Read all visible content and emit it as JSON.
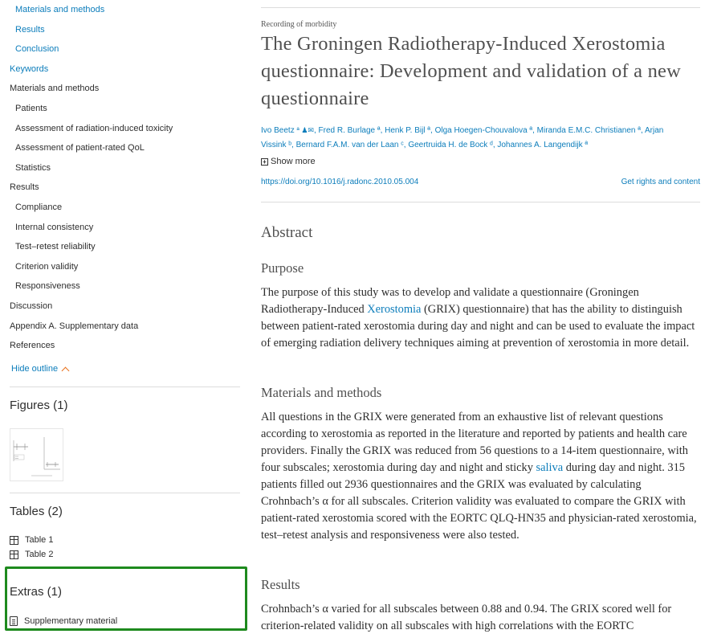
{
  "outline": {
    "items": [
      {
        "label": "Materials and methods",
        "level": 2,
        "link": true
      },
      {
        "label": "Results",
        "level": 2,
        "link": true
      },
      {
        "label": "Conclusion",
        "level": 2,
        "link": true
      },
      {
        "label": "Keywords",
        "level": 1,
        "link": true
      },
      {
        "label": "Materials and methods",
        "level": 1,
        "link": false
      },
      {
        "label": "Patients",
        "level": 2,
        "link": false
      },
      {
        "label": "Assessment of radiation-induced toxicity",
        "level": 2,
        "link": false
      },
      {
        "label": "Assessment of patient-rated QoL",
        "level": 2,
        "link": false
      },
      {
        "label": "Statistics",
        "level": 2,
        "link": false
      },
      {
        "label": "Results",
        "level": 1,
        "link": false
      },
      {
        "label": "Compliance",
        "level": 2,
        "link": false
      },
      {
        "label": "Internal consistency",
        "level": 2,
        "link": false
      },
      {
        "label": "Test–retest reliability",
        "level": 2,
        "link": false
      },
      {
        "label": "Criterion validity",
        "level": 2,
        "link": false
      },
      {
        "label": "Responsiveness",
        "level": 2,
        "link": false
      },
      {
        "label": "Discussion",
        "level": 1,
        "link": false
      },
      {
        "label": "Appendix A. Supplementary data",
        "level": 1,
        "link": false
      },
      {
        "label": "References",
        "level": 1,
        "link": false
      }
    ],
    "hide_label": "Hide outline"
  },
  "figures": {
    "title": "Figures (1)"
  },
  "tables": {
    "title": "Tables (2)",
    "items": [
      "Table 1",
      "Table 2"
    ]
  },
  "extras": {
    "title": "Extras (1)",
    "items": [
      "Supplementary material"
    ]
  },
  "article": {
    "subject": "Recording of morbidity",
    "title": "The Groningen Radiotherapy-Induced Xerostomia questionnaire: Development and validation of a new questionnaire",
    "authors_line1": "Ivo Beetz",
    "authors_line1_rest": ", Fred R. Burlage ª, Henk P. Bijl ª, Olga Hoegen-Chouvalova ª, Miranda E.M.C. Christianen ª, Arjan",
    "authors_line2": "Vissink ᵇ, Bernard F.A.M. van der Laan ᶜ, Geertruida H. de Bock ᵈ, Johannes A. Langendijk ª",
    "show_more": "Show more",
    "doi": "https://doi.org/10.1016/j.radonc.2010.05.004",
    "rights": "Get rights and content"
  },
  "abstract": {
    "heading": "Abstract",
    "purpose": {
      "heading": "Purpose",
      "text_a": "The purpose of this study was to develop and validate a questionnaire (Groningen Radiotherapy-Induced ",
      "link": "Xerostomia",
      "text_b": " (GRIX) questionnaire) that has the ability to distinguish between patient-rated xerostomia during day and night and can be used to evaluate the impact of emerging radiation delivery techniques aiming at prevention of xerostomia in more detail."
    },
    "methods": {
      "heading": "Materials and methods",
      "text_a": "All questions in the GRIX were generated from an exhaustive list of relevant questions according to xerostomia as reported in the literature and reported by patients and health care providers. Finally the GRIX was reduced from 56 questions to a 14-item questionnaire, with four subscales; xerostomia during day and night and sticky ",
      "link": "saliva",
      "text_b": " during day and night. 315 patients filled out 2936 questionnaires and the GRIX was evaluated by calculating Crohnbach’s α for all subscales. Criterion validity was evaluated to compare the GRIX with patient-rated xerostomia scored with the EORTC QLQ-HN35 and physician-rated xerostomia, test–retest analysis and responsiveness were also tested."
    },
    "results": {
      "heading": "Results",
      "text": "Crohnbach’s α varied for all subscales between 0.88 and 0.94. The GRIX scored well for criterion-related validity on all subscales with high correlations with the EORTC"
    }
  },
  "colors": {
    "link": "#0c7dbb",
    "accent": "#e9711c",
    "highlight_box": "#1e8a1e"
  }
}
